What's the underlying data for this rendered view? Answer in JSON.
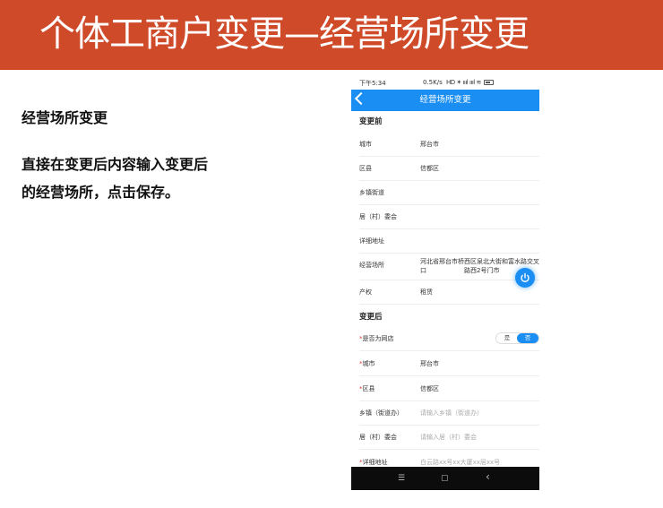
{
  "banner": {
    "title": "个体工商户变更—经营场所变更"
  },
  "left": {
    "heading": "经营场所变更",
    "desc_line1": "直接在变更后内容输入变更后",
    "desc_line2": "的经营场所，点击保存。"
  },
  "phone": {
    "status": {
      "time": "下午5:34",
      "net": "0.5K/s",
      "signal": "HD ✶ ıııl ıııl ≋",
      "battery": "battery-icon"
    },
    "titlebar": {
      "title": "经营场所变更",
      "back_icon": "back-arrow-icon"
    },
    "before": {
      "heading": "变更前",
      "rows": [
        {
          "label": "城市",
          "value": "邢台市"
        },
        {
          "label": "区县",
          "value": "信都区"
        },
        {
          "label": "乡镇街道",
          "value": ""
        },
        {
          "label": "居（村）委会",
          "value": ""
        },
        {
          "label": "详细地址",
          "value": ""
        },
        {
          "label": "经营场所",
          "value": "河北省邢台市桥西区泉北大街和富水路交叉口　　　　　　路西2号门市"
        },
        {
          "label": "产权",
          "value": "租赁"
        }
      ]
    },
    "after": {
      "heading": "变更后",
      "online_store": {
        "label": "是否为网店",
        "yes": "是",
        "no": "否",
        "selected": "否"
      },
      "city": {
        "label": "城市",
        "value": "邢台市"
      },
      "district": {
        "label": "区县",
        "value": "信都区"
      },
      "town": {
        "label": "乡镇（街道办）",
        "placeholder": "请输入乡镇（街道办）"
      },
      "village": {
        "label": "居（村）委会",
        "placeholder": "请输入居（村）委会"
      },
      "address": {
        "label": "详细地址",
        "placeholder": "白云路xx号xx大厦xx层xx号"
      }
    },
    "fab_icon": "power-icon",
    "navbar": {
      "menu": "☰",
      "home": "▢",
      "back": "‹"
    },
    "colors": {
      "primary": "#1a8ef2",
      "banner": "#cf4a29",
      "required": "#e23b3b"
    }
  }
}
